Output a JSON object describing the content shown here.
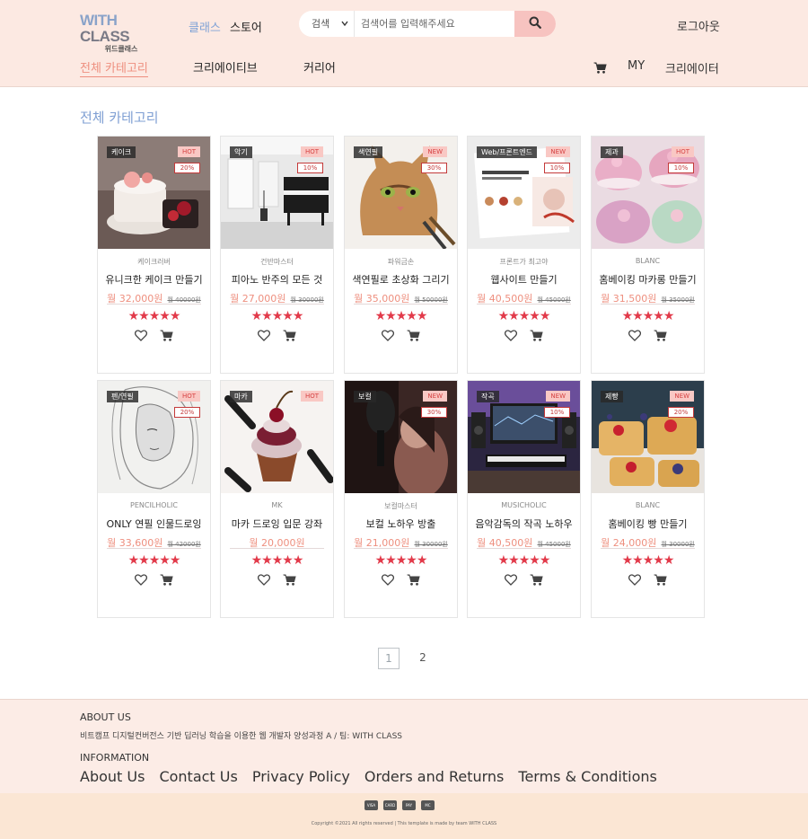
{
  "brand": {
    "logo_word1": "WITH",
    "logo_word2": "CLASS",
    "logo_sub": "위드클래스"
  },
  "header": {
    "links": [
      "클래스",
      "스토어"
    ],
    "search": {
      "select_value": "검색",
      "placeholder": "검색어를 입력해주세요"
    },
    "logout": "로그아웃",
    "nav": [
      "전체 카테고리",
      "크리에이티브",
      "커리어"
    ],
    "right_nav": {
      "my": "MY",
      "creator": "크리에이터"
    }
  },
  "page_title": "전체 카테고리",
  "products": [
    {
      "category": "케이크",
      "badge": "HOT",
      "discount": "20%",
      "creator": "케이크러버",
      "title": "유니크한 케이크 만들기",
      "price": "월 32,000원",
      "original": "월 40000원",
      "stars": "★★★★★",
      "image": "cake"
    },
    {
      "category": "악기",
      "badge": "HOT",
      "discount": "10%",
      "creator": "건반마스터",
      "title": "피아노 반주의 모든 것",
      "price": "월 27,000원",
      "original": "월 30000원",
      "stars": "★★★★★",
      "image": "piano"
    },
    {
      "category": "색연필",
      "badge": "NEW",
      "discount": "30%",
      "creator": "파워금손",
      "title": "색연필로 초상화 그리기",
      "price": "월 35,000원",
      "original": "월 50000원",
      "stars": "★★★★★",
      "image": "cat"
    },
    {
      "category": "Web/프론트엔드",
      "badge": "NEW",
      "discount": "10%",
      "creator": "프론트가 최고야",
      "title": "웹사이트 만들기",
      "price": "월 40,500원",
      "original": "월 45000원",
      "stars": "★★★★★",
      "image": "web"
    },
    {
      "category": "제과",
      "badge": "HOT",
      "discount": "10%",
      "creator": "BLANC",
      "title": "홈베이킹 마카롱 만들기",
      "price": "월 31,500원",
      "original": "월 35000원",
      "stars": "★★★★★",
      "image": "macaron"
    },
    {
      "category": "펜/연필",
      "badge": "HOT",
      "discount": "20%",
      "creator": "PENCILHOLIC",
      "title": "ONLY 연필 인물드로잉",
      "price": "월 33,600원",
      "original": "월 42000원",
      "stars": "★★★★★",
      "image": "sketch"
    },
    {
      "category": "마카",
      "badge": "HOT",
      "discount": "",
      "creator": "MK",
      "title": "마카 드로잉 입문 강좌",
      "price": "월 20,000원",
      "original": "",
      "stars": "★★★★★",
      "image": "cupcake"
    },
    {
      "category": "보컬",
      "badge": "NEW",
      "discount": "30%",
      "creator": "보컬마스터",
      "title": "보컬 노하우 방출",
      "price": "월 21,000원",
      "original": "월 30000원",
      "stars": "★★★★★",
      "image": "vocal"
    },
    {
      "category": "작곡",
      "badge": "NEW",
      "discount": "10%",
      "creator": "MUSICHOLIC",
      "title": "음악감독의 작곡 노하우",
      "price": "월 40,500원",
      "original": "월 45000원",
      "stars": "★★★★★",
      "image": "studio"
    },
    {
      "category": "제빵",
      "badge": "NEW",
      "discount": "20%",
      "creator": "BLANC",
      "title": "홈베이킹 빵 만들기",
      "price": "월 24,000원",
      "original": "월 30000원",
      "stars": "★★★★★",
      "image": "bread"
    }
  ],
  "pagination": [
    "1",
    "2"
  ],
  "footer": {
    "about_heading": "ABOUT US",
    "about_text": "비트캠프 디지털컨버전스 기반 딥러닝 학습을 이용한 웹 개발자 양성과정 A / 팀: WITH CLASS",
    "info_heading": "INFORMATION",
    "links": [
      "About Us",
      "Contact Us",
      "Privacy Policy",
      "Orders and Returns",
      "Terms & Conditions"
    ],
    "payments": [
      "VISA",
      "CARD",
      "PAY",
      "MC"
    ],
    "copyright": "Copyright ©2021 All rights reserved | This template is made by team WITH CLASS"
  },
  "colors": {
    "header_bg": "#fce9e2",
    "accent_pink": "#ee8f7f",
    "link_blue": "#7fa2d6",
    "star_red": "#e23a4a"
  }
}
